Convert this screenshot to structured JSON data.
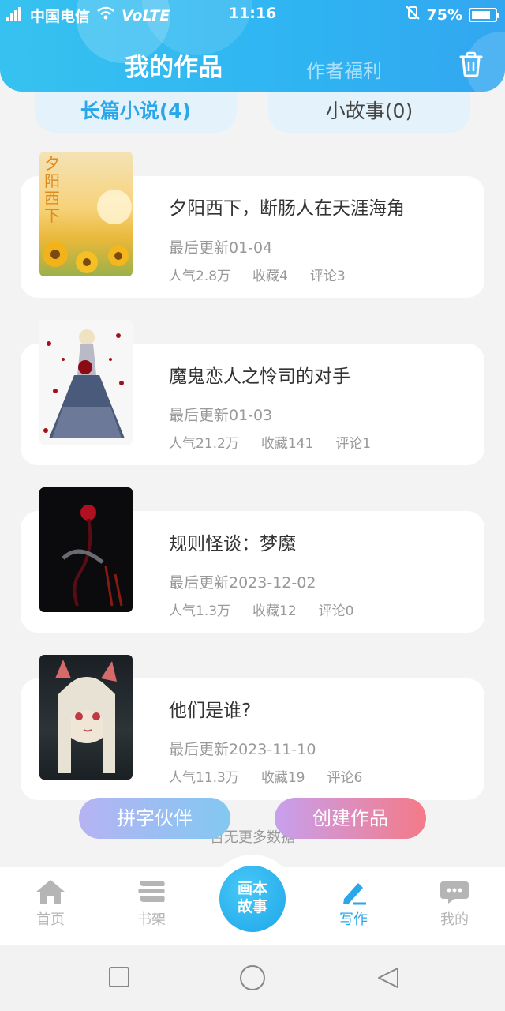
{
  "status_bar": {
    "carrier": "中国电信",
    "network": "4G",
    "volte": "VoLTE",
    "time": "11:16",
    "battery_percent": "75%",
    "battery_level": 0.75
  },
  "header": {
    "title": "我的作品",
    "subtitle": "作者福利"
  },
  "tabs": [
    {
      "label": "长篇小说(4)",
      "active": true
    },
    {
      "label": "小故事(0)",
      "active": false
    }
  ],
  "works": [
    {
      "title": "夕阳西下，断肠人在天涯海角",
      "updated": "最后更新01-04",
      "popularity": "人气2.8万",
      "favorites": "收藏4",
      "comments": "评论3",
      "cover_text": "夕阳西下"
    },
    {
      "title": "魔鬼恋人之怜司的对手",
      "updated": "最后更新01-03",
      "popularity": "人气21.2万",
      "favorites": "收藏141",
      "comments": "评论1"
    },
    {
      "title": "规则怪谈：梦魔",
      "updated": "最后更新2023-12-02",
      "popularity": "人气1.3万",
      "favorites": "收藏12",
      "comments": "评论0"
    },
    {
      "title": "他们是谁?",
      "updated": "最后更新2023-11-10",
      "popularity": "人气11.3万",
      "favorites": "收藏19",
      "comments": "评论6"
    }
  ],
  "float_buttons": {
    "partner": "拼字伙伴",
    "create": "创建作品"
  },
  "footer_note": "暂无更多数据",
  "bottom_nav": [
    {
      "label": "首页",
      "icon": "home-icon",
      "active": false
    },
    {
      "label": "书架",
      "icon": "bookshelf-icon",
      "active": false
    },
    {
      "label": "画本故事",
      "icon": "picture-story-icon",
      "active": false
    },
    {
      "label": "写作",
      "icon": "pen-icon",
      "active": true
    },
    {
      "label": "我的",
      "icon": "chat-bubble-icon",
      "active": false
    }
  ],
  "center_button": {
    "line1": "画本",
    "line2": "故事"
  },
  "colors": {
    "accent": "#2aa6ea",
    "header_gradient_start": "#36c2f0",
    "header_gradient_end": "#32a6f0",
    "partner_gradient": [
      "#b6b3f3",
      "#82c8f1"
    ],
    "create_gradient": [
      "#c7a0ee",
      "#f47a88"
    ]
  }
}
